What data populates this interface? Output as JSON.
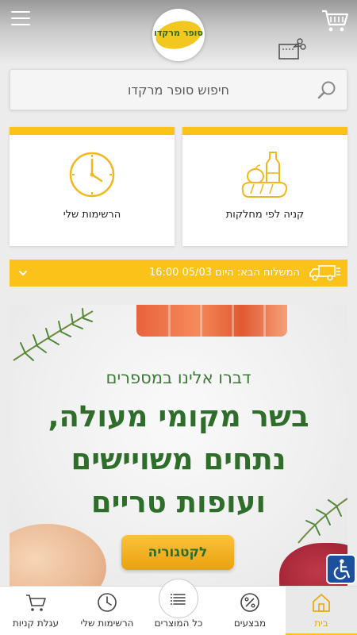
{
  "header": {
    "logo_text": "סופר מרקדו",
    "menu_icon": "hamburger-icon",
    "cart_icon": "cart-icon",
    "scissors_icon": "scissors-icon"
  },
  "search": {
    "placeholder": "חיפוש סופר מרקדו",
    "icon": "search-icon"
  },
  "cards": [
    {
      "label": "הרשימות שלי",
      "icon": "clock-icon"
    },
    {
      "label": "קניה לפי מחלקות",
      "icon": "groceries-icon"
    }
  ],
  "delivery": {
    "text": "המשלוח הבא: היום 05/03 16:00",
    "icon": "truck-icon",
    "chevron": "chevron-down-icon"
  },
  "banner": {
    "subtitle": "דברו אלינו במספרים",
    "headline_lines": [
      "בשר מקומי מעולה,",
      "נתחים משויישים",
      "ועופות טריים"
    ],
    "cta": "לקטגוריה"
  },
  "accessibility_icon": "wheelchair-icon",
  "bottom_nav": [
    {
      "label": "עגלת קניות",
      "icon": "cart-icon",
      "active": false
    },
    {
      "label": "הרשימות שלי",
      "icon": "clock-icon",
      "active": false
    },
    {
      "label": "כל המוצרים",
      "icon": "list-icon",
      "active": false
    },
    {
      "label": "מבצעים",
      "icon": "percent-icon",
      "active": false
    },
    {
      "label": "בית",
      "icon": "home-icon",
      "active": true
    }
  ],
  "colors": {
    "accent_yellow": "#fbc219",
    "brand_green": "#2e6e2a",
    "accessibility_blue": "#1c4f9c"
  }
}
